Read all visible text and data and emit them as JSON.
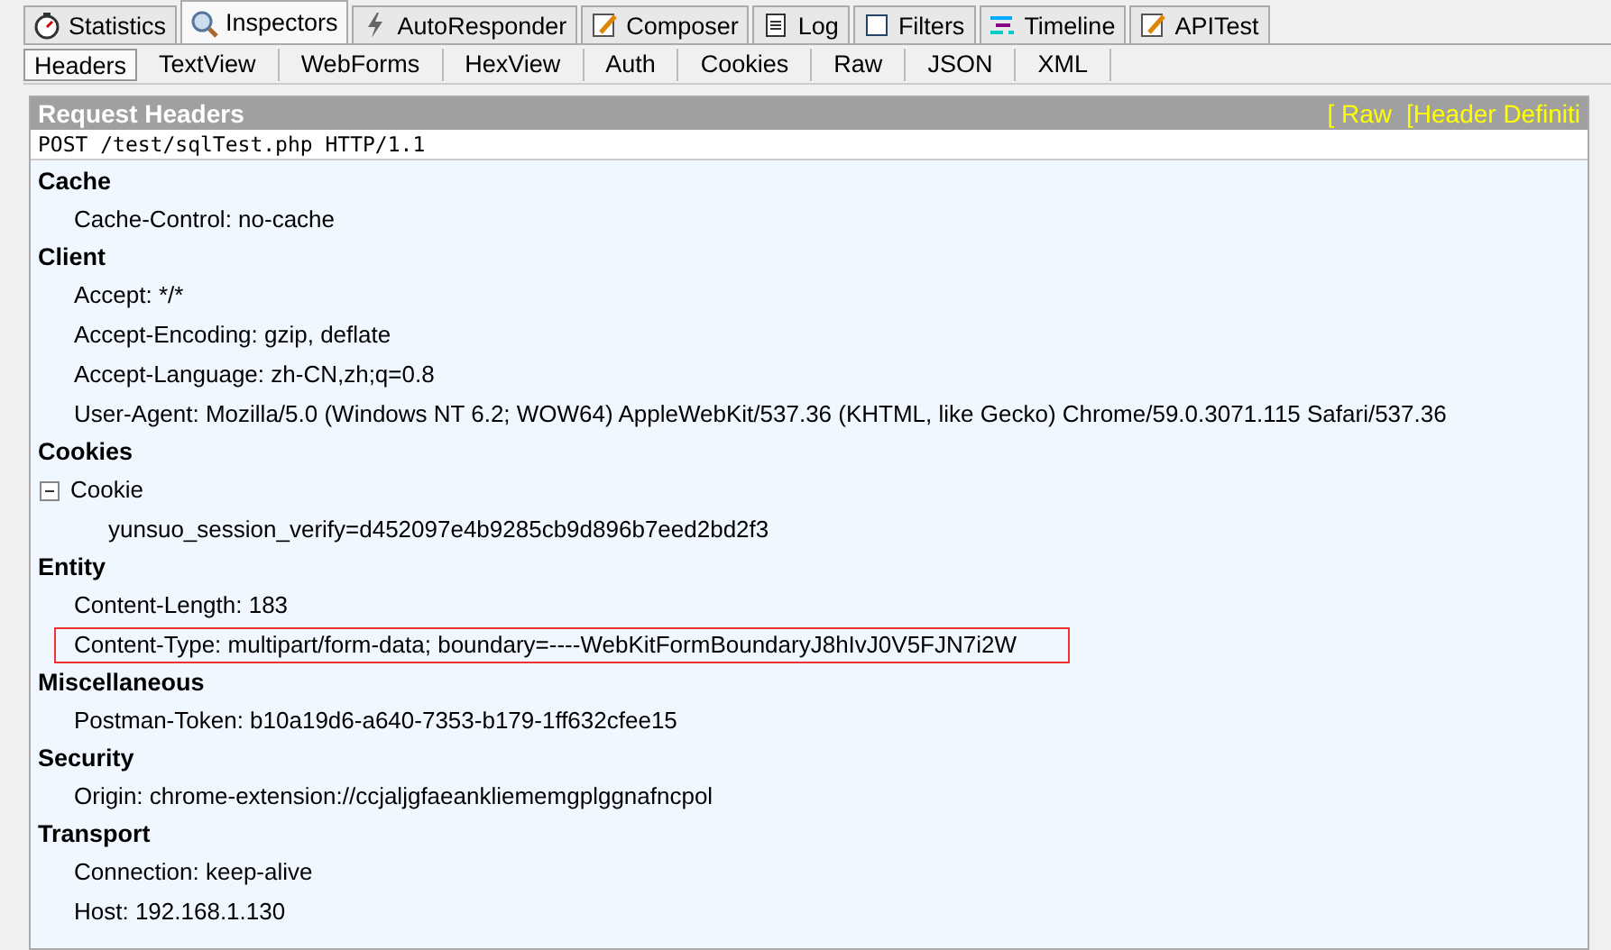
{
  "main_tabs": [
    {
      "label": "Statistics",
      "selected": false
    },
    {
      "label": "Inspectors",
      "selected": true
    },
    {
      "label": "AutoResponder",
      "selected": false
    },
    {
      "label": "Composer",
      "selected": false
    },
    {
      "label": "Log",
      "selected": false
    },
    {
      "label": "Filters",
      "selected": false
    },
    {
      "label": "Timeline",
      "selected": false
    },
    {
      "label": "APITest",
      "selected": false
    }
  ],
  "sub_tabs": [
    {
      "label": "Headers",
      "selected": true
    },
    {
      "label": "TextView",
      "selected": false
    },
    {
      "label": "WebForms",
      "selected": false
    },
    {
      "label": "HexView",
      "selected": false
    },
    {
      "label": "Auth",
      "selected": false
    },
    {
      "label": "Cookies",
      "selected": false
    },
    {
      "label": "Raw",
      "selected": false
    },
    {
      "label": "JSON",
      "selected": false
    },
    {
      "label": "XML",
      "selected": false
    }
  ],
  "header_bar": {
    "title": "Request Headers",
    "links": [
      "[ Raw",
      "[Header Definiti"
    ]
  },
  "request_line": "POST /test/sqlTest.php HTTP/1.1",
  "groups": [
    {
      "name": "Cache",
      "children": [
        {
          "text": "Cache-Control: no-cache",
          "highlighted": false
        }
      ]
    },
    {
      "name": "Client",
      "children": [
        {
          "text": "Accept: */*",
          "highlighted": false
        },
        {
          "text": "Accept-Encoding: gzip, deflate",
          "highlighted": false
        },
        {
          "text": "Accept-Language: zh-CN,zh;q=0.8",
          "highlighted": false
        },
        {
          "text": "User-Agent: Mozilla/5.0 (Windows NT 6.2; WOW64) AppleWebKit/537.36 (KHTML, like Gecko) Chrome/59.0.3071.115 Safari/537.36",
          "highlighted": false
        }
      ]
    },
    {
      "name": "Cookies",
      "children": [
        {
          "text": "Cookie",
          "highlighted": false,
          "expanded": true,
          "children": [
            {
              "text": "yunsuo_session_verify=d452097e4b9285cb9d896b7eed2bd2f3",
              "highlighted": false
            }
          ]
        }
      ]
    },
    {
      "name": "Entity",
      "children": [
        {
          "text": "Content-Length: 183",
          "highlighted": false
        },
        {
          "text": "Content-Type: multipart/form-data; boundary=----WebKitFormBoundaryJ8hIvJ0V5FJN7i2W",
          "highlighted": true
        }
      ]
    },
    {
      "name": "Miscellaneous",
      "children": [
        {
          "text": "Postman-Token: b10a19d6-a640-7353-b179-1ff632cfee15",
          "highlighted": false
        }
      ]
    },
    {
      "name": "Security",
      "children": [
        {
          "text": "Origin: chrome-extension://ccjaljgfaeankliememgplggnafncpol",
          "highlighted": false
        }
      ]
    },
    {
      "name": "Transport",
      "children": [
        {
          "text": "Connection: keep-alive",
          "highlighted": false
        },
        {
          "text": "Host: 192.168.1.130",
          "highlighted": false
        }
      ]
    }
  ]
}
